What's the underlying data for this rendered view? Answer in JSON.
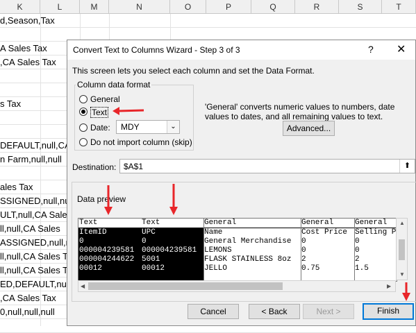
{
  "spreadsheet": {
    "columns": [
      "K",
      "L",
      "M",
      "N",
      "O",
      "P",
      "Q",
      "R",
      "S",
      "T"
    ],
    "rows": [
      "d,Season,Tax",
      "",
      "A Sales Tax",
      ",CA Sales Tax",
      "",
      "",
      "s Tax",
      "",
      "",
      "DEFAULT,null,CA S",
      "n Farm,null,null",
      "",
      "ales Tax",
      "SSIGNED,null,nu",
      "ULT,null,CA Sale",
      "ll,null,CA Sales",
      "ASSIGNED,null,nu",
      "ll,null,CA Sales T",
      "ll,null,CA Sales Tax",
      "ED,DEFAULT,null",
      ",CA Sales Tax",
      "0,null,null,null",
      ""
    ]
  },
  "dialog": {
    "title": "Convert Text to Columns Wizard - Step 3 of 3",
    "help_label": "?",
    "close_label": "✕",
    "description": "This screen lets you select each column and set the Data Format.",
    "format_group_label": "Column data format",
    "options": {
      "general": "General",
      "text": "Text",
      "date": "Date:",
      "skip": "Do not import column (skip)"
    },
    "selected_option": "Text",
    "date_format": "MDY",
    "info_text": "'General' converts numeric values to numbers, date values to dates, and all remaining values to text.",
    "advanced_label": "Advanced...",
    "destination_label": "Destination:",
    "destination_value": "$A$1",
    "preview_label": "Data preview",
    "preview": {
      "columns": [
        {
          "header": "Text",
          "cells": [
            "ItemID",
            "0",
            "000004239581",
            "000004244622",
            "00012"
          ]
        },
        {
          "header": "Text",
          "cells": [
            "UPC",
            "0",
            "000004239581",
            "5001",
            "00012"
          ]
        },
        {
          "header": "General",
          "cells": [
            "Name",
            "General Merchandise",
            "LEMONS",
            "FLASK STAINLESS 8oz",
            "JELLO"
          ]
        },
        {
          "header": "General",
          "cells": [
            "Cost Price",
            "0",
            "0",
            "2",
            "0.75"
          ]
        },
        {
          "header": "General",
          "cells": [
            "Selling P",
            "0",
            "0",
            "2",
            "1.5"
          ]
        }
      ]
    },
    "buttons": {
      "cancel": "Cancel",
      "back": "< Back",
      "next": "Next >",
      "finish": "Finish"
    }
  },
  "colors": {
    "annotation_arrow": "#e8262a",
    "accent": "#0078d7"
  }
}
